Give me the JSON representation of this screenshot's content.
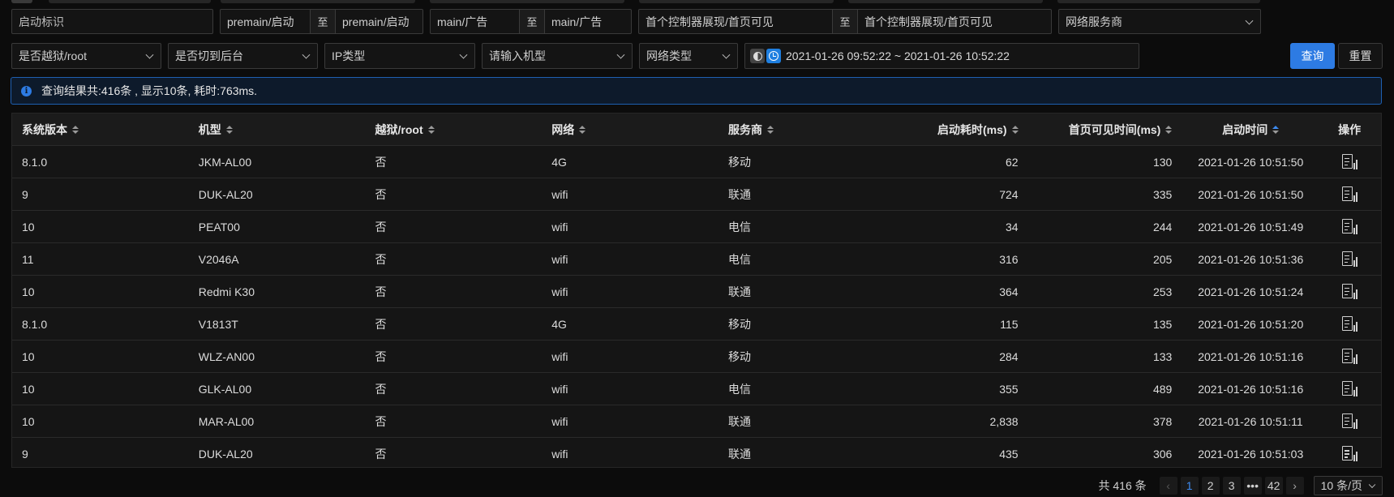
{
  "filters": {
    "launch_id_placeholder": "启动标识",
    "range1": {
      "from": "premain/启动",
      "sep": "至",
      "to": "premain/启动"
    },
    "range2": {
      "from": "main/广告",
      "sep": "至",
      "to": "main/广告"
    },
    "range3": {
      "from": "首个控制器展现/首页可见",
      "sep": "至",
      "to": "首个控制器展现/首页可见"
    },
    "carrier_select": "网络服务商",
    "jailbreak_select": "是否越狱/root",
    "background_select": "是否切到后台",
    "ip_type_select": "IP类型",
    "model_select": "请输入机型",
    "network_type_select": "网络类型",
    "date_range": "2021-01-26 09:52:22  ~  2021-01-26 10:52:22",
    "query_button": "查询",
    "reset_button": "重置"
  },
  "alert": {
    "text": "查询结果共:416条 , 显示10条, 耗时:763ms."
  },
  "table": {
    "headers": {
      "os_version": "系统版本",
      "model": "机型",
      "jailbreak": "越狱/root",
      "network": "网络",
      "carrier": "服务商",
      "launch_cost": "启动耗时(ms)",
      "first_visible": "首页可见时间(ms)",
      "launch_time": "启动时间",
      "actions": "操作"
    },
    "sorted_column": "launch_time",
    "rows": [
      {
        "os_version": "8.1.0",
        "model": "JKM-AL00",
        "jailbreak": "否",
        "network": "4G",
        "carrier": "移动",
        "launch_cost": "62",
        "first_visible": "130",
        "launch_time": "2021-01-26 10:51:50"
      },
      {
        "os_version": "9",
        "model": "DUK-AL20",
        "jailbreak": "否",
        "network": "wifi",
        "carrier": "联通",
        "launch_cost": "724",
        "first_visible": "335",
        "launch_time": "2021-01-26 10:51:50"
      },
      {
        "os_version": "10",
        "model": "PEAT00",
        "jailbreak": "否",
        "network": "wifi",
        "carrier": "电信",
        "launch_cost": "34",
        "first_visible": "244",
        "launch_time": "2021-01-26 10:51:49"
      },
      {
        "os_version": "11",
        "model": "V2046A",
        "jailbreak": "否",
        "network": "wifi",
        "carrier": "电信",
        "launch_cost": "316",
        "first_visible": "205",
        "launch_time": "2021-01-26 10:51:36"
      },
      {
        "os_version": "10",
        "model": "Redmi K30",
        "jailbreak": "否",
        "network": "wifi",
        "carrier": "联通",
        "launch_cost": "364",
        "first_visible": "253",
        "launch_time": "2021-01-26 10:51:24"
      },
      {
        "os_version": "8.1.0",
        "model": "V1813T",
        "jailbreak": "否",
        "network": "4G",
        "carrier": "移动",
        "launch_cost": "115",
        "first_visible": "135",
        "launch_time": "2021-01-26 10:51:20"
      },
      {
        "os_version": "10",
        "model": "WLZ-AN00",
        "jailbreak": "否",
        "network": "wifi",
        "carrier": "移动",
        "launch_cost": "284",
        "first_visible": "133",
        "launch_time": "2021-01-26 10:51:16"
      },
      {
        "os_version": "10",
        "model": "GLK-AL00",
        "jailbreak": "否",
        "network": "wifi",
        "carrier": "电信",
        "launch_cost": "355",
        "first_visible": "489",
        "launch_time": "2021-01-26 10:51:16"
      },
      {
        "os_version": "10",
        "model": "MAR-AL00",
        "jailbreak": "否",
        "network": "wifi",
        "carrier": "联通",
        "launch_cost": "2,838",
        "first_visible": "378",
        "launch_time": "2021-01-26 10:51:11"
      },
      {
        "os_version": "9",
        "model": "DUK-AL20",
        "jailbreak": "否",
        "network": "wifi",
        "carrier": "联通",
        "launch_cost": "435",
        "first_visible": "306",
        "launch_time": "2021-01-26 10:51:03"
      }
    ],
    "row_action_icon": "document-chart-icon"
  },
  "pagination": {
    "total": "共 416 条",
    "pages": [
      "1",
      "2",
      "3",
      "•••",
      "42"
    ],
    "current": "1",
    "page_size": "10 条/页"
  },
  "colors": {
    "accent": "#2d7be3",
    "background": "#0c0c0c",
    "table_bg": "#151515",
    "alert_border": "#1e5fb0"
  }
}
